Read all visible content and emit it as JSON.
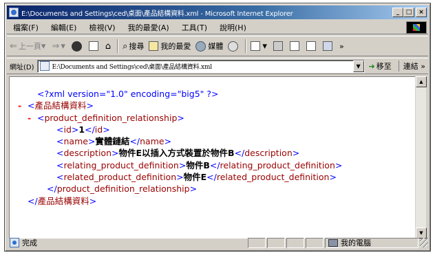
{
  "window": {
    "title": "E:\\Documents and Settings\\ced\\桌面\\產品結構資料.xml - Microsoft Internet Explorer",
    "minimize_label": "_",
    "maximize_label": "□",
    "close_label": "×"
  },
  "menu": [
    "檔案(F)",
    "編輯(E)",
    "檢視(V)",
    "我的最愛(A)",
    "工具(T)",
    "說明(H)"
  ],
  "toolbar": {
    "back_label": "上一頁",
    "search_label": "搜尋",
    "favorites_label": "我的最愛",
    "media_label": "媒體",
    "more_label": "»"
  },
  "address": {
    "label": "網址(D)",
    "value": "E:\\Documents and Settings\\ced\\桌面\\產品結構資料.xml",
    "go_label": "移至",
    "links_label": "連結 »"
  },
  "xml": {
    "declaration": "<?xml version=\"1.0\" encoding=\"big5\" ?>",
    "root_tag": "產品結構資料",
    "relationship_tag": "product_definition_relationship",
    "fields": [
      {
        "tag": "id",
        "value": "1"
      },
      {
        "tag": "name",
        "value": "實體鏈結"
      },
      {
        "tag": "description",
        "value": "物件E以插入方式裝置於物件B"
      },
      {
        "tag": "relating_product_definition",
        "value": "物件B"
      },
      {
        "tag": "related_product_definition",
        "value": "物件E"
      }
    ]
  },
  "status": {
    "text": "完成",
    "zone_label": "我的電腦"
  },
  "colors": {
    "titlebar_start": "#0a246a",
    "xml_tag": "#990000",
    "xml_bracket": "#0000ff",
    "collapse_marker": "#ff0000"
  }
}
